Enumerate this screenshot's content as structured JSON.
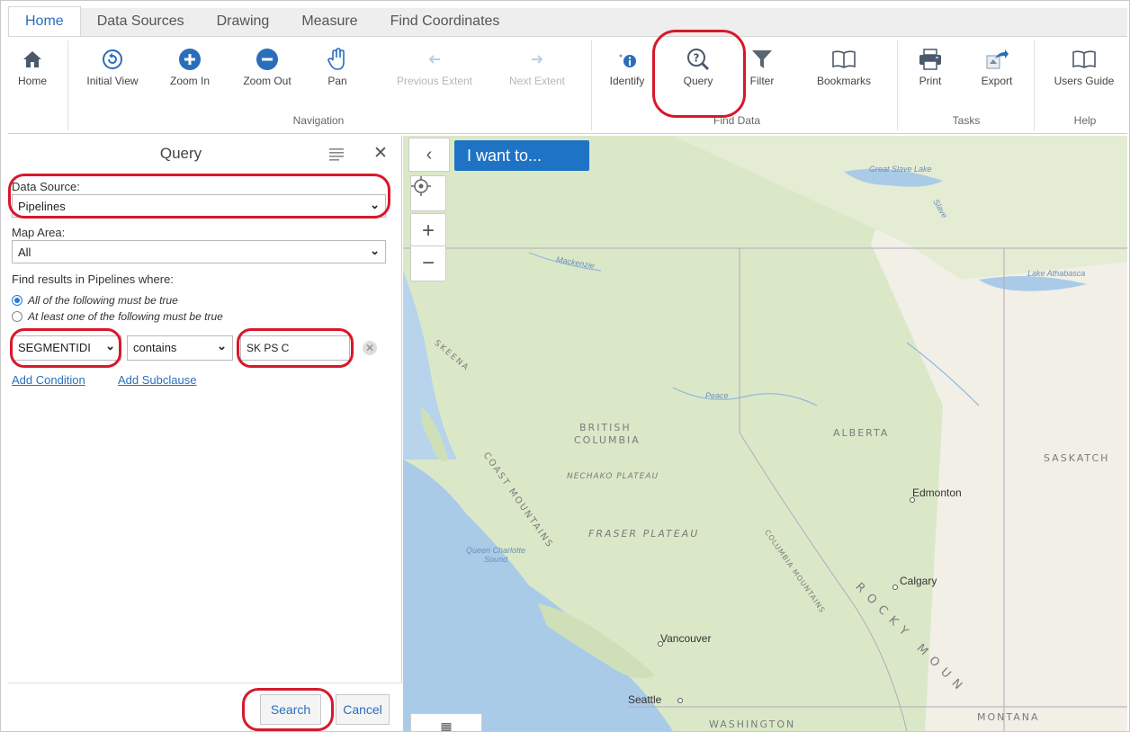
{
  "tabs": [
    "Home",
    "Data Sources",
    "Drawing",
    "Measure",
    "Find Coordinates"
  ],
  "ribbon": {
    "home": "Home",
    "navigation": {
      "initial_view": "Initial View",
      "zoom_in": "Zoom In",
      "zoom_out": "Zoom Out",
      "pan": "Pan",
      "previous_extent": "Previous Extent",
      "next_extent": "Next Extent",
      "group_label": "Navigation"
    },
    "find_data": {
      "identify": "Identify",
      "query": "Query",
      "filter": "Filter",
      "bookmarks": "Bookmarks",
      "group_label": "Find Data"
    },
    "tasks": {
      "print": "Print",
      "export": "Export",
      "group_label": "Tasks"
    },
    "help": {
      "users_guide": "Users Guide",
      "group_label": "Help"
    }
  },
  "panel": {
    "title": "Query",
    "data_source_label": "Data Source:",
    "data_source_value": "Pipelines",
    "map_area_label": "Map Area:",
    "map_area_value": "All",
    "find_results_label": "Find results in Pipelines where:",
    "radio_all": "All of the following must be true",
    "radio_any": "At least one of the following must be true",
    "condition": {
      "field": "SEGMENTIDI",
      "operator": "contains",
      "value": "SK PS C"
    },
    "add_condition": "Add Condition",
    "add_subclause": "Add Subclause",
    "search_button": "Search",
    "cancel_button": "Cancel"
  },
  "map": {
    "i_want_to": "I want to...",
    "labels": {
      "great_slave_lake": "Great Slave Lake",
      "lake_athabasca": "Lake Athabasca",
      "mackenzie": "Mackenzie",
      "peace": "Peace",
      "british_columbia_1": "BRITISH",
      "british_columbia_2": "COLUMBIA",
      "alberta": "ALBERTA",
      "saskatchewan": "SASKATCH",
      "nechako_plateau": "NECHAKO PLATEAU",
      "fraser_plateau": "FRASER PLATEAU",
      "edmonton": "Edmonton",
      "calgary": "Calgary",
      "vancouver": "Vancouver",
      "seattle": "Seattle",
      "washington": "WASHINGTON",
      "montana": "MONTANA",
      "queen_charlotte_sound": "Queen Charlotte Sound",
      "rocky_mountains": "ROCKY MOUN",
      "coast_mountains": "COAST MOUNTAINS",
      "columbia_mountains": "COLUMBIA MOUNTAINS",
      "skeena": "SKEENA",
      "slave": "Slave"
    }
  },
  "colors": {
    "accent": "#2a6ebb",
    "highlight": "#d7192a",
    "iwant_bg": "#1e73c5",
    "water": "#a9cbe8",
    "land": "#f1efe6",
    "forest": "#dbe8c8"
  }
}
